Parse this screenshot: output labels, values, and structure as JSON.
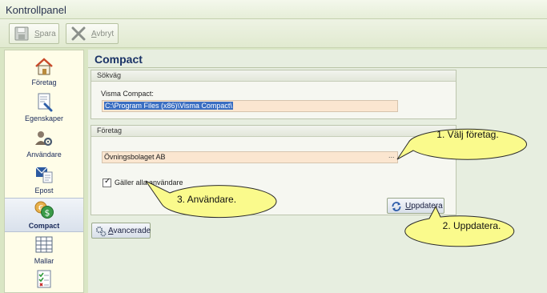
{
  "window": {
    "title": "Kontrollpanel"
  },
  "toolbar": {
    "save_label": "Spara",
    "cancel_label": "Avbryt"
  },
  "sidebar": {
    "items": [
      {
        "label": "Företag",
        "icon": "house-icon"
      },
      {
        "label": "Egenskaper",
        "icon": "properties-icon"
      },
      {
        "label": "Användare",
        "icon": "users-icon"
      },
      {
        "label": "Epost",
        "icon": "email-icon"
      },
      {
        "label": "Compact",
        "icon": "compact-money-icon",
        "active": true
      },
      {
        "label": "Mallar",
        "icon": "templates-icon"
      },
      {
        "label": "",
        "icon": "checklist-icon"
      }
    ]
  },
  "main": {
    "title": "Compact",
    "path_group": {
      "header": "Sökväg",
      "field_label": "Visma Compact:",
      "field_value": "C:\\Program Files (x86)\\Visma Compact\\"
    },
    "company_group": {
      "header": "Företag",
      "company_value": "Övningsbolaget AB",
      "browse_label": "...",
      "checkbox_label": "Gäller alla användare",
      "checkbox_checked": true,
      "update_label": "Uppdatera"
    },
    "advanced_label": "Avancerade"
  },
  "callouts": [
    {
      "text": "1. Välj företag."
    },
    {
      "text": "2. Uppdatera."
    },
    {
      "text": "3. Användare."
    }
  ],
  "colors": {
    "accent": "#1a3266",
    "selection": "#3a6ec2",
    "field_bg": "#fbe6d0",
    "callout_fill": "#fafa8c"
  }
}
